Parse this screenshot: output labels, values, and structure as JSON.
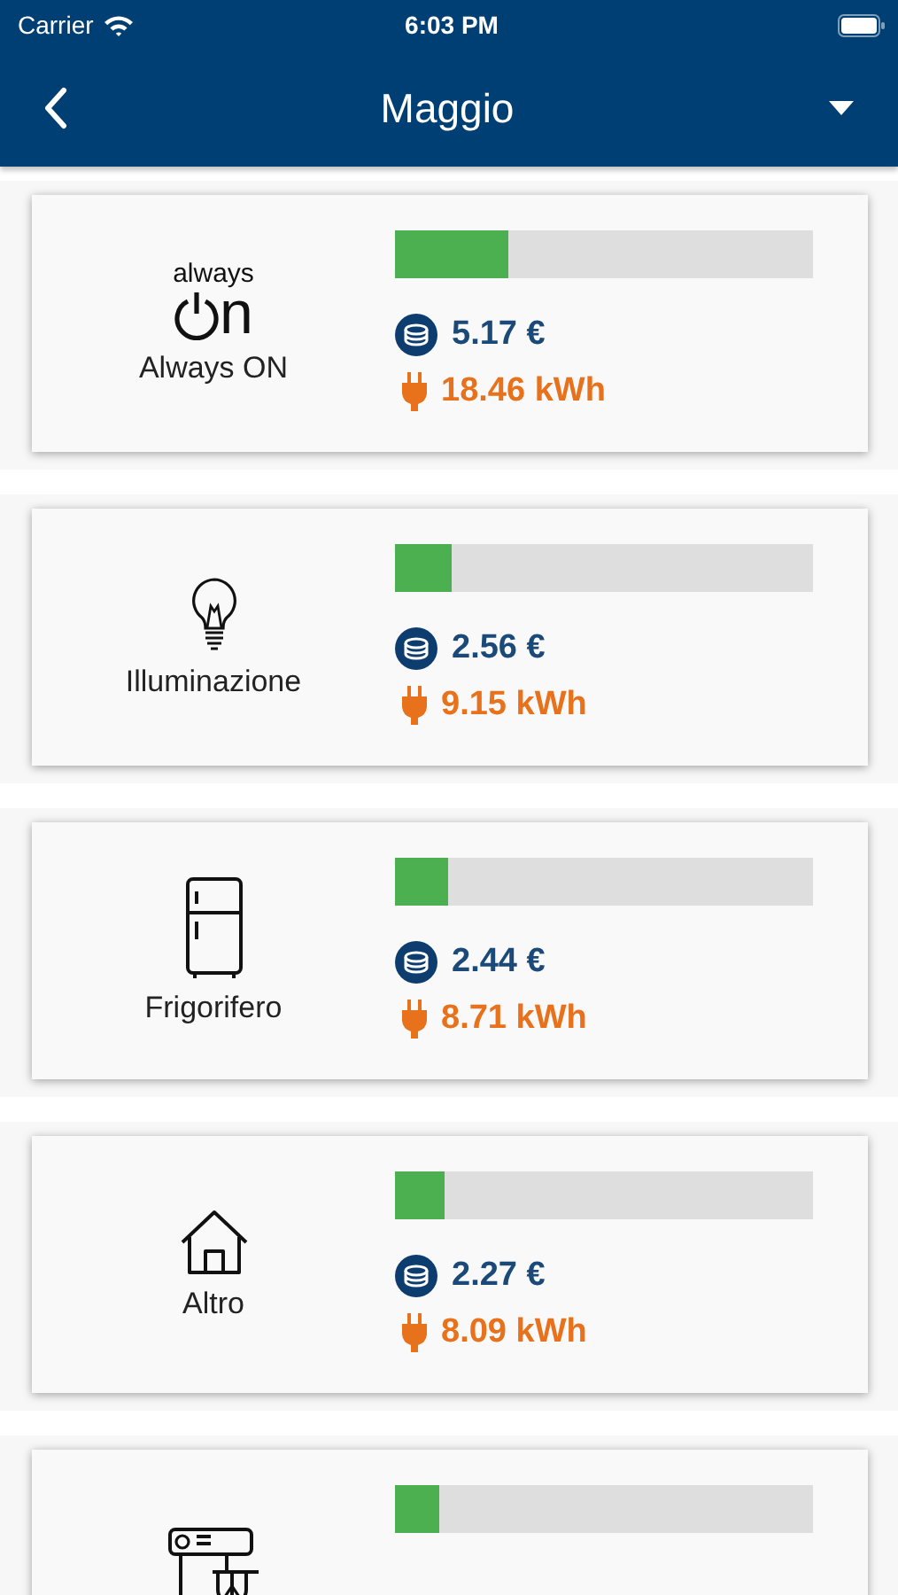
{
  "status_bar": {
    "carrier": "Carrier",
    "time": "6:03 PM"
  },
  "nav": {
    "title": "Maggio"
  },
  "items": [
    {
      "kind": "always_on",
      "logo_top": "always",
      "logo_bottom": "n",
      "label": "Always ON",
      "level": 0.27,
      "cost": "5.17 €",
      "energy": "18.46 kWh"
    },
    {
      "kind": "bulb",
      "label": "Illuminazione",
      "level": 0.135,
      "cost": "2.56 €",
      "energy": "9.15 kWh"
    },
    {
      "kind": "fridge",
      "label": "Frigorifero",
      "level": 0.127,
      "cost": "2.44 €",
      "energy": "8.71 kWh"
    },
    {
      "kind": "house",
      "label": "Altro",
      "level": 0.12,
      "cost": "2.27 €",
      "energy": "8.09 kWh"
    },
    {
      "kind": "mixer",
      "level": 0.105
    }
  ]
}
